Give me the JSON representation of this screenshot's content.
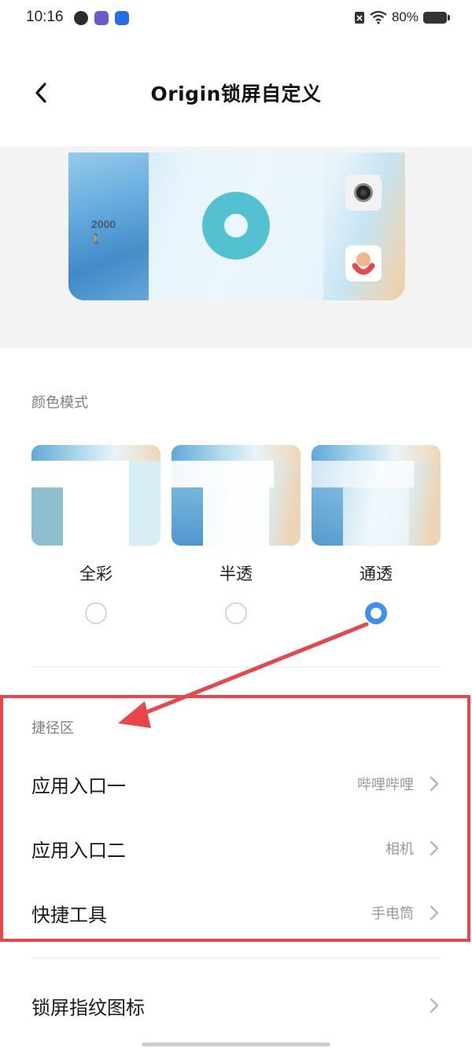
{
  "status_bar": {
    "time": "10:16",
    "battery": "80%",
    "battery_level": 0.8
  },
  "header": {
    "title": "Origin锁屏自定义"
  },
  "preview": {
    "steps": "2000",
    "walk_icon": "walk-icon",
    "camera_icon": "camera-icon",
    "app_icon": "app-icon",
    "ring_color": "#53c1d2"
  },
  "color_mode": {
    "section_label": "颜色模式",
    "options": [
      {
        "label": "全彩",
        "selected": false
      },
      {
        "label": "半透",
        "selected": false
      },
      {
        "label": "通透",
        "selected": true
      }
    ],
    "selected_color": "#3f8ef0"
  },
  "shortcut": {
    "section_label": "捷径区",
    "items": [
      {
        "title": "应用入口一",
        "value": "哔哩哔哩"
      },
      {
        "title": "应用入口二",
        "value": "相机"
      },
      {
        "title": "快捷工具",
        "value": "手电筒"
      }
    ]
  },
  "fingerprint": {
    "title": "锁屏指纹图标"
  },
  "annotation_color": "#e8464b"
}
